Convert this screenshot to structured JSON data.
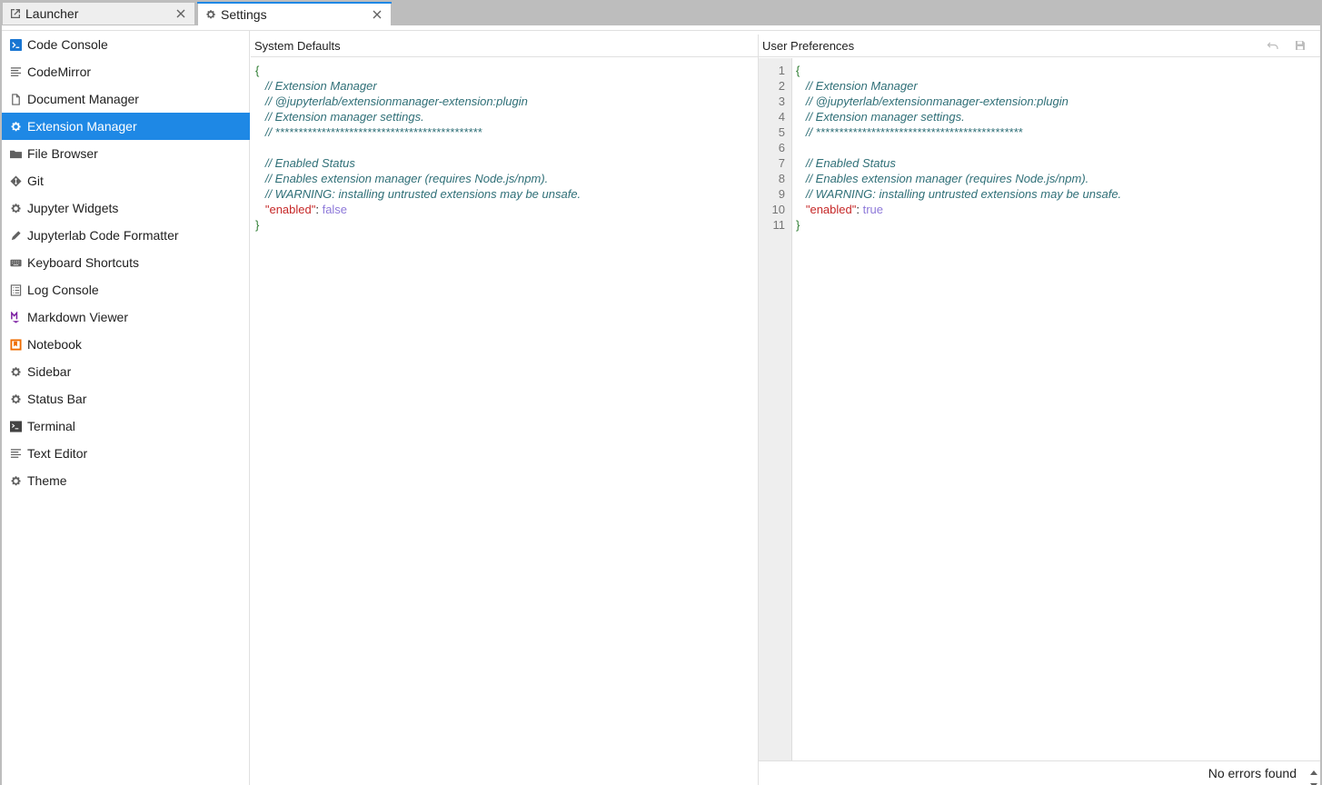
{
  "tabs": [
    {
      "label": "Launcher",
      "icon": "launch-icon",
      "active": false
    },
    {
      "label": "Settings",
      "icon": "gear-icon",
      "active": true
    }
  ],
  "sidebar": {
    "items": [
      {
        "label": "Code Console",
        "icon": "console-icon"
      },
      {
        "label": "CodeMirror",
        "icon": "text-lines-icon"
      },
      {
        "label": "Document Manager",
        "icon": "file-icon"
      },
      {
        "label": "Extension Manager",
        "icon": "gear-icon",
        "active": true
      },
      {
        "label": "File Browser",
        "icon": "folder-icon"
      },
      {
        "label": "Git",
        "icon": "git-icon"
      },
      {
        "label": "Jupyter Widgets",
        "icon": "gear-icon"
      },
      {
        "label": "Jupyterlab Code Formatter",
        "icon": "pencil-icon"
      },
      {
        "label": "Keyboard Shortcuts",
        "icon": "keyboard-icon"
      },
      {
        "label": "Log Console",
        "icon": "list-icon"
      },
      {
        "label": "Markdown Viewer",
        "icon": "markdown-icon"
      },
      {
        "label": "Notebook",
        "icon": "notebook-icon"
      },
      {
        "label": "Sidebar",
        "icon": "gear-icon"
      },
      {
        "label": "Status Bar",
        "icon": "gear-icon"
      },
      {
        "label": "Terminal",
        "icon": "terminal-icon"
      },
      {
        "label": "Text Editor",
        "icon": "text-lines-icon"
      },
      {
        "label": "Theme",
        "icon": "gear-icon"
      }
    ]
  },
  "system_defaults": {
    "title": "System Defaults",
    "lines": {
      "open": "{",
      "c1": "// Extension Manager",
      "c2": "// @jupyterlab/extensionmanager-extension:plugin",
      "c3": "// Extension manager settings.",
      "c4": "// *********************************************",
      "c5": "// Enabled Status",
      "c6": "// Enables extension manager (requires Node.js/npm).",
      "c7": "// WARNING: installing untrusted extensions may be unsafe.",
      "key": "\"enabled\"",
      "colon": ": ",
      "value": "false",
      "close": "}"
    }
  },
  "user_preferences": {
    "title": "User Preferences",
    "line_numbers": [
      "1",
      "2",
      "3",
      "4",
      "5",
      "6",
      "7",
      "8",
      "9",
      "10",
      "11"
    ],
    "lines": {
      "open": "{",
      "c1": "// Extension Manager",
      "c2": "// @jupyterlab/extensionmanager-extension:plugin",
      "c3": "// Extension manager settings.",
      "c4": "// *********************************************",
      "c5": "// Enabled Status",
      "c6": "// Enables extension manager (requires Node.js/npm).",
      "c7": "// WARNING: installing untrusted extensions may be unsafe.",
      "key": "\"enabled\"",
      "colon": ": ",
      "value": "true",
      "close": "}"
    },
    "status": "No errors found"
  },
  "colors": {
    "accent": "#1e88e5",
    "comment": "#2f6f77",
    "key": "#c62828",
    "boolean": "#8e79d9",
    "brace": "#2e7d32"
  }
}
